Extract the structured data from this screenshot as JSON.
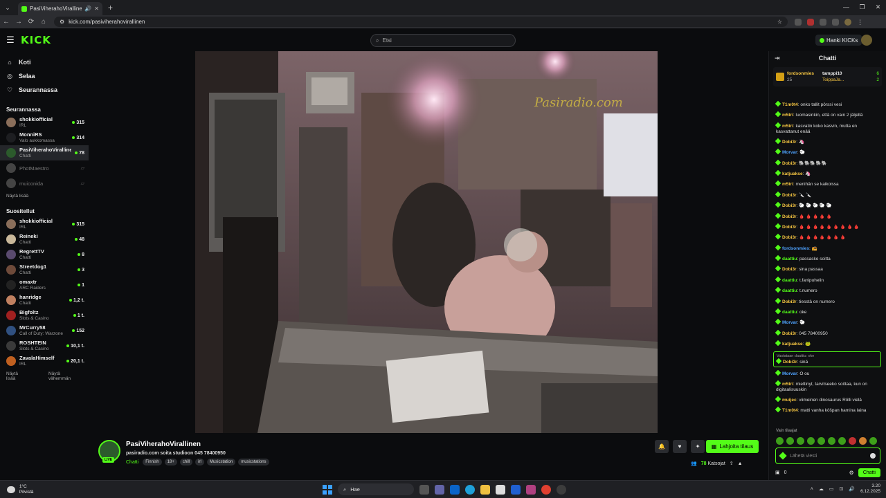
{
  "browser": {
    "tab_title": "PasiViherahoVirallinen Stre",
    "url": "kick.com/pasiviherahovirallinen"
  },
  "header": {
    "logo": "KICK",
    "search_placeholder": "Etsi",
    "kicks_button": "Hanki KICKs"
  },
  "sidebar": {
    "nav": [
      {
        "label": "Koti",
        "icon": "home-icon"
      },
      {
        "label": "Selaa",
        "icon": "browse-icon"
      },
      {
        "label": "Seurannassa",
        "icon": "heart-icon"
      }
    ],
    "following_title": "Seurannassa",
    "following": [
      {
        "name": "shokkiofficial",
        "category": "IRL",
        "viewers": "315",
        "avatar_color": "#8a6e5a"
      },
      {
        "name": "MonniRS",
        "category": "Valo aukkomassa",
        "viewers": "314",
        "avatar_color": "#1d1e21"
      },
      {
        "name": "PasiViherahoVirallinen",
        "category": "Chatti",
        "viewers": "78",
        "avatar_color": "#2c5a2c"
      },
      {
        "name": "PhotMaestro",
        "category": "",
        "viewers": "",
        "avatar_color": "#444"
      },
      {
        "name": "muiconida",
        "category": "",
        "viewers": "",
        "avatar_color": "#444"
      }
    ],
    "show_more": "Näytä lisää",
    "recommended_title": "Suositellut",
    "recommended": [
      {
        "name": "shokkiofficial",
        "category": "IRL",
        "viewers": "315",
        "avatar_color": "#8a6e5a"
      },
      {
        "name": "Reineki",
        "category": "Chatti",
        "viewers": "48",
        "avatar_color": "#c9b89a"
      },
      {
        "name": "RegrettTV",
        "category": "Chatti",
        "viewers": "8",
        "avatar_color": "#5a4a6e"
      },
      {
        "name": "Streetdog1",
        "category": "Chatti",
        "viewers": "3",
        "avatar_color": "#6e4a3a"
      },
      {
        "name": "omaxtr",
        "category": "ARC Raiders",
        "viewers": "1",
        "avatar_color": "#222"
      },
      {
        "name": "hanridge",
        "category": "Chatti",
        "viewers": "1,2 t.",
        "avatar_color": "#c08060"
      },
      {
        "name": "Bigfoltz",
        "category": "Slots & Casino",
        "viewers": "1 t.",
        "avatar_color": "#a02020"
      },
      {
        "name": "MrCurry58",
        "category": "Call of Duty: Warzone",
        "viewers": "152",
        "avatar_color": "#305080"
      },
      {
        "name": "ROSHTEIN",
        "category": "Slots & Casino",
        "viewers": "10,1 t.",
        "avatar_color": "#3a3a3a"
      },
      {
        "name": "ZavalaHimself",
        "category": "IRL",
        "viewers": "20,1 t.",
        "avatar_color": "#c06020"
      }
    ],
    "show_more_2": "Näytä lisää",
    "show_less": "Näytä vähemmän"
  },
  "stream": {
    "channel_name": "PasiViherahoVirallinen",
    "title": "pasiradio.com soita studioon 045 78400950",
    "live_badge": "LIVE",
    "category": "Chatti",
    "tags": [
      "Finnish",
      "18+",
      "chill",
      "irl",
      "Musicstation",
      "musicstations"
    ],
    "gift_button": "Lahjoita tilaus",
    "viewers": "78",
    "viewers_label": "Katsojat",
    "watermark": "Pasiradio.com"
  },
  "chat": {
    "title": "Chatti",
    "pinned": [
      {
        "name": "fordsonmies",
        "amount": "25"
      },
      {
        "name": "tamppi10",
        "amount": "6"
      },
      {
        "name": "ToippaJa...",
        "amount": "2"
      }
    ],
    "messages": [
      {
        "user": "T1m0t4",
        "color": "#f5c542",
        "text": "onko tallit pörssi vesi"
      },
      {
        "user": "m5tri",
        "color": "#f5c542",
        "text": "luomasinkin, että on vain 2 jäljellä"
      },
      {
        "user": "m5tri",
        "color": "#f5c542",
        "text": "kasvatin koko kasvin, mutta en kasvattanut enää"
      },
      {
        "user": "Dobi3r",
        "color": "#f5c542",
        "text": "🦄"
      },
      {
        "user": "Morvar",
        "color": "#4fa3ff",
        "text": "🐑"
      },
      {
        "user": "Dobi3r",
        "color": "#f5c542",
        "text": "🐘🐘🐘🐘🐘"
      },
      {
        "user": "katjuakse",
        "color": "#f5c542",
        "text": "🦄"
      },
      {
        "user": "m5tri",
        "color": "#f5c542",
        "text": "menihän se kaikoissa"
      },
      {
        "user": "Dobi3r",
        "color": "#f5c542",
        "text": "🔪 🔪"
      },
      {
        "user": "Dobi3r",
        "color": "#f5c542",
        "text": "🐑 🐑 🐑 🐑 🐑"
      },
      {
        "user": "Dobi3r",
        "color": "#f5c542",
        "text": "🩸 🩸 🩸 🩸 🩸"
      },
      {
        "user": "Dobi3r",
        "color": "#f5c542",
        "text": "🩸 🩸 🩸 🩸 🩸 🩸 🩸 🩸 🩸"
      },
      {
        "user": "Dobi3r",
        "color": "#f5c542",
        "text": "🩸 🩸 🩸 🩸 🩸 🩸 🩸"
      },
      {
        "user": "fordsonmies",
        "color": "#4fa3ff",
        "text": "📻"
      },
      {
        "user": "daattiu",
        "color": "#53fc18",
        "text": "passasko soitta"
      },
      {
        "user": "Dobi3r",
        "color": "#f5c542",
        "text": "sina passaa"
      },
      {
        "user": "daattiu",
        "color": "#53fc18",
        "text": "t.fanipuhelin"
      },
      {
        "user": "daattiu",
        "color": "#53fc18",
        "text": "t.numero"
      },
      {
        "user": "Dobi3r",
        "color": "#f5c542",
        "text": "tiesstä on numero"
      },
      {
        "user": "daattiu",
        "color": "#53fc18",
        "text": "oke"
      },
      {
        "user": "Morvar",
        "color": "#4fa3ff",
        "text": "🐑"
      },
      {
        "user": "Dobi3r",
        "color": "#f5c542",
        "text": "045 78400950"
      },
      {
        "user": "katjuakse",
        "color": "#f5c542",
        "text": "🐸"
      }
    ],
    "reply": {
      "reply_to": "Vastataan daattiu: oke",
      "user": "Dobi3r",
      "text": "sinä"
    },
    "messages_after": [
      {
        "user": "Morvar",
        "color": "#4fa3ff",
        "text": "O ou"
      },
      {
        "user": "m5tri",
        "color": "#f5c542",
        "text": "miettinyt, tarvitseeko soittaa, kun on digitaalisuuskin"
      },
      {
        "user": "muijec",
        "color": "#f5c542",
        "text": "viimeinen dinosaurus Rölli vielä"
      },
      {
        "user": "T1m0t4",
        "color": "#f5c542",
        "text": "matti vanha köšpan hamina laina"
      }
    ],
    "subs_only": "Vain tilaajat",
    "input_placeholder": "Lähetä viesti",
    "points": "0",
    "send_button": "Chatti"
  },
  "taskbar": {
    "temperature": "1°C",
    "weather": "Pilvistä",
    "search": "Hae",
    "time": "3.20",
    "date": "6.12.2025"
  }
}
